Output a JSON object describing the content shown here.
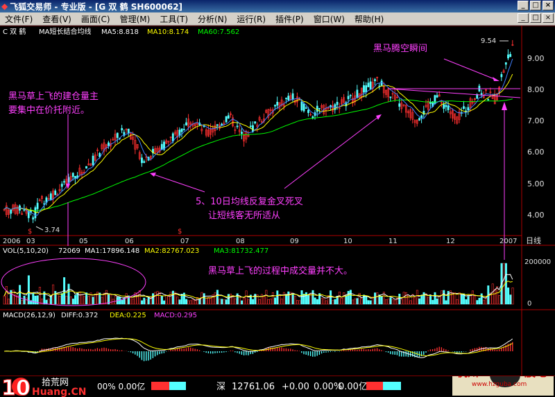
{
  "window": {
    "title": "飞狐交易师 - 专业版 - [G 双 鹤 SH600062]",
    "buttons": [
      "_",
      "□",
      "×"
    ]
  },
  "menu": {
    "items": [
      "文件(F)",
      "查看(V)",
      "画面(C)",
      "管理(M)",
      "工具(T)",
      "分析(N)",
      "运行(R)",
      "插件(P)",
      "窗口(W)",
      "帮助(H)"
    ],
    "mdi_buttons": [
      "_",
      "□",
      "×"
    ]
  },
  "price_panel": {
    "stock_label": "C 双 鹤",
    "indicator": "MA短长结合均线",
    "ma5_label": "MA5:8.818",
    "ma10_label": "MA10:8.174",
    "ma60_label": "MA60:7.562",
    "y_ticks": [
      "9.00",
      "8.00",
      "7.00",
      "6.00",
      "5.00",
      "4.00"
    ],
    "high_label": "9.54",
    "low_label": "3.74"
  },
  "x_axis": {
    "labels": [
      "2006",
      "03",
      "05",
      "06",
      "07",
      "08",
      "09",
      "10",
      "11",
      "12",
      "2007"
    ],
    "period": "日线"
  },
  "vol_panel": {
    "header": "VOL(5,10,20)",
    "value": "72069",
    "ma1": "MA1:17896.148",
    "ma2": "MA2:82767.023",
    "ma3": "MA3:81732.477",
    "y_ticks": [
      "200000",
      "0"
    ]
  },
  "macd_panel": {
    "header": "MACD(26,12,9)",
    "diff": "DIFF:0.372",
    "dea": "DEA:0.225",
    "macd": "MACD:0.295"
  },
  "annotations": {
    "a1_line1": "黑马草上飞的建仓量主",
    "a1_line2": "要集中在价托附近。",
    "a2": "黑马腾空瞬间",
    "a3_line1": "5、10日均线反复金叉死叉",
    "a3_line2": "让短线客无所适从",
    "a4": "黑马草上飞的过程中成交量并不大。"
  },
  "status_bar": {
    "left": "00% 0.00亿",
    "index_name": "深",
    "index_value": "12761.06",
    "index_change": "+0.00",
    "index_pct": "0.00%",
    "index_amount": "0.00亿"
  },
  "watermarks": {
    "left_num": "10",
    "left_cn": "拾荒网",
    "left_url": "Huang.CN",
    "right_cn": "杭州",
    "right_cn2": "股吧",
    "right_url": "www.hzguba.com"
  },
  "colors": {
    "up": "#ff3030",
    "down": "#54ffff",
    "ma5": "#ffffff",
    "ma10": "#ffff00",
    "ma60": "#00ff00",
    "annotation": "#ff40ff",
    "axis": "#b00000"
  }
}
